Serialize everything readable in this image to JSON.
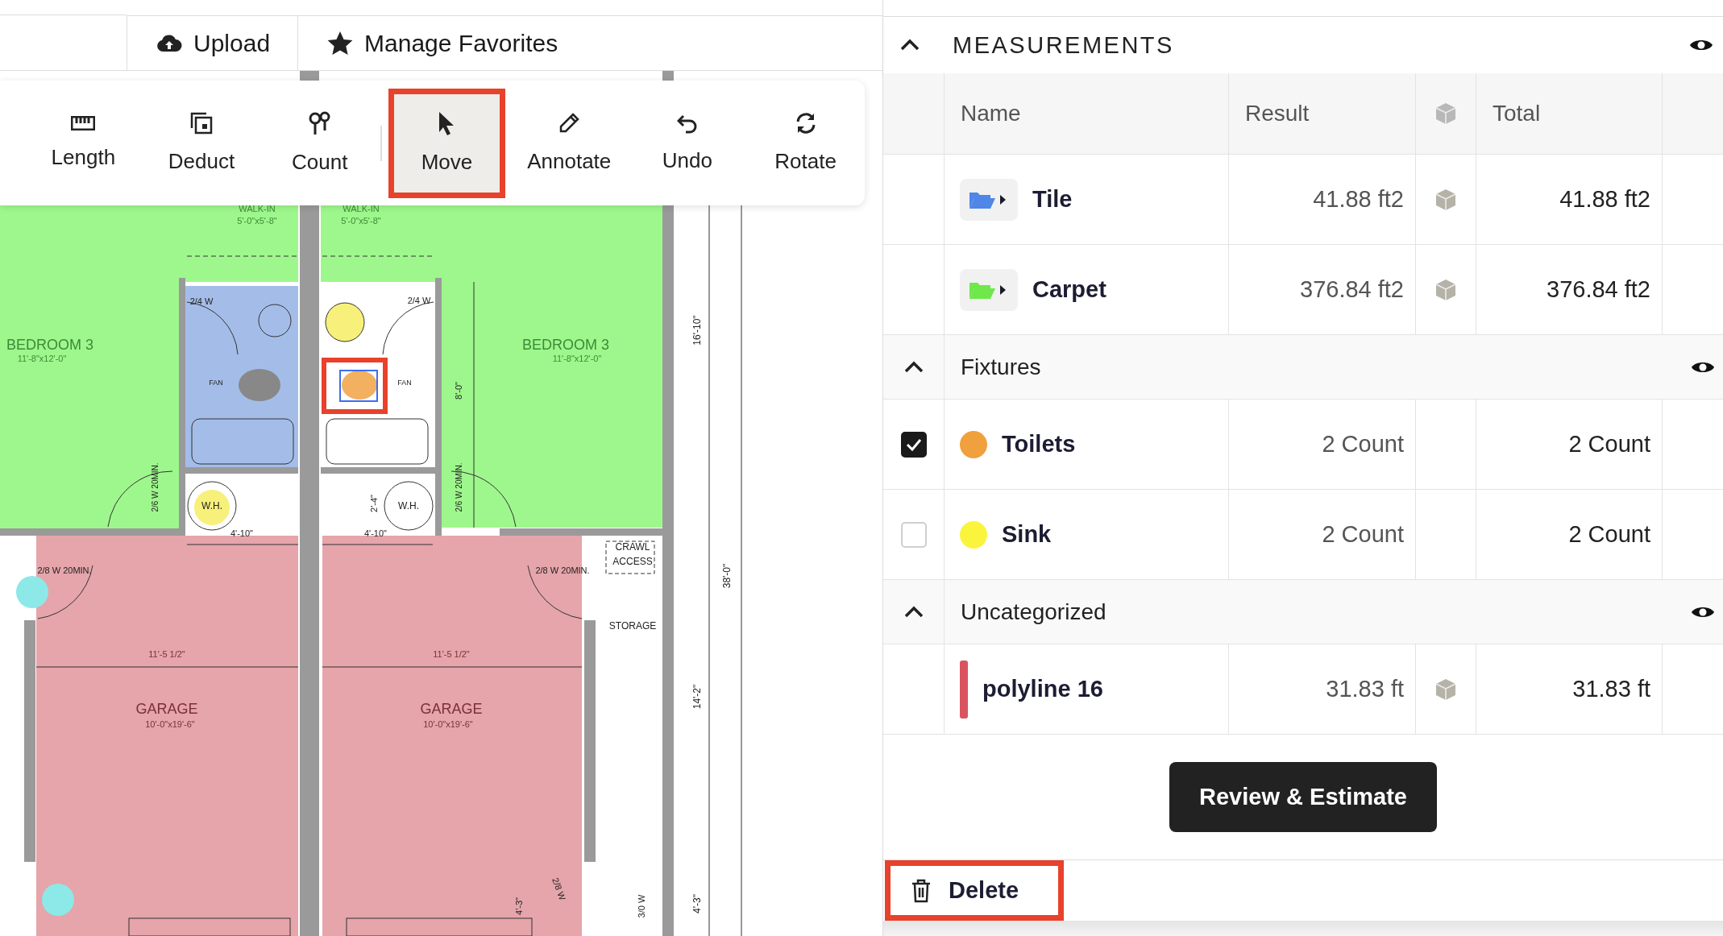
{
  "top_bar": {
    "buttons": [
      {
        "label": "Upload",
        "kind": "upload"
      },
      {
        "label": "Manage Favorites",
        "kind": "star"
      }
    ]
  },
  "tools": [
    {
      "label": "Length",
      "kind": "length",
      "selected": false
    },
    {
      "label": "Deduct",
      "kind": "deduct",
      "selected": false
    },
    {
      "label": "Count",
      "kind": "count",
      "selected": false
    },
    {
      "label": "Move",
      "kind": "move",
      "selected": true
    },
    {
      "label": "Annotate",
      "kind": "annotate",
      "selected": false
    },
    {
      "label": "Undo",
      "kind": "undo",
      "selected": false
    },
    {
      "label": "Rotate",
      "kind": "rotate",
      "selected": false
    }
  ],
  "plan": {
    "labels": [
      "WALK-IN",
      "5'-0\"x5'-8\"",
      "WALK-IN",
      "5'-0\"x5'-8\"",
      "BEDROOM 3",
      "11'-8\"x12'-0\"",
      "BEDROOM 3",
      "11'-8\"x12'-0\"",
      "2/4 W",
      "2/4 W",
      "FAN",
      "FAN",
      "W.H.",
      "W.H.",
      "4'-10\"",
      "4'-10\"",
      "2/8 W 20MIN.",
      "2/8 W 20MIN.",
      "CRAWL",
      "ACCESS",
      "STORAGE",
      "11'-5 1/2\"",
      "11'-5 1/2\"",
      "GARAGE",
      "10'-0\"x19'-6\"",
      "GARAGE",
      "10'-0\"x19'-6\"",
      "16'-10\"",
      "8'-0\"",
      "38'-0\"",
      "14'-2\"",
      "4'-3\"",
      "2/6 W 20MIN.",
      "2/6 W 20MIN.",
      "3/0 W",
      "2'-4\"",
      "2/8 W",
      "4'-3\""
    ]
  },
  "measurements": {
    "title": "MEASUREMENTS",
    "columns": [
      "Name",
      "Result",
      "Total"
    ],
    "sections": [
      {
        "rows": [
          {
            "name": "Tile",
            "result": "41.88 ft2",
            "total": "41.88 ft2",
            "kind": "folder",
            "color": "#4f86e8"
          },
          {
            "name": "Carpet",
            "result": "376.84 ft2",
            "total": "376.84 ft2",
            "kind": "folder",
            "color": "#6ee84a"
          }
        ]
      },
      {
        "title": "Fixtures",
        "expanded": true,
        "rows": [
          {
            "name": "Toilets",
            "result": "2 Count",
            "total": "2 Count",
            "kind": "count",
            "color": "#f0a03c",
            "checked": true
          },
          {
            "name": "Sink",
            "result": "2 Count",
            "total": "2 Count",
            "kind": "count",
            "color": "#fbf43c",
            "checked": false
          }
        ]
      },
      {
        "title": "Uncategorized",
        "expanded": true,
        "rows": [
          {
            "name": "polyline 16",
            "result": "31.83 ft",
            "total": "31.83 ft",
            "kind": "line",
            "color": "#d9545f"
          }
        ]
      }
    ]
  },
  "review_button": "Review & Estimate",
  "delete_button": "Delete"
}
